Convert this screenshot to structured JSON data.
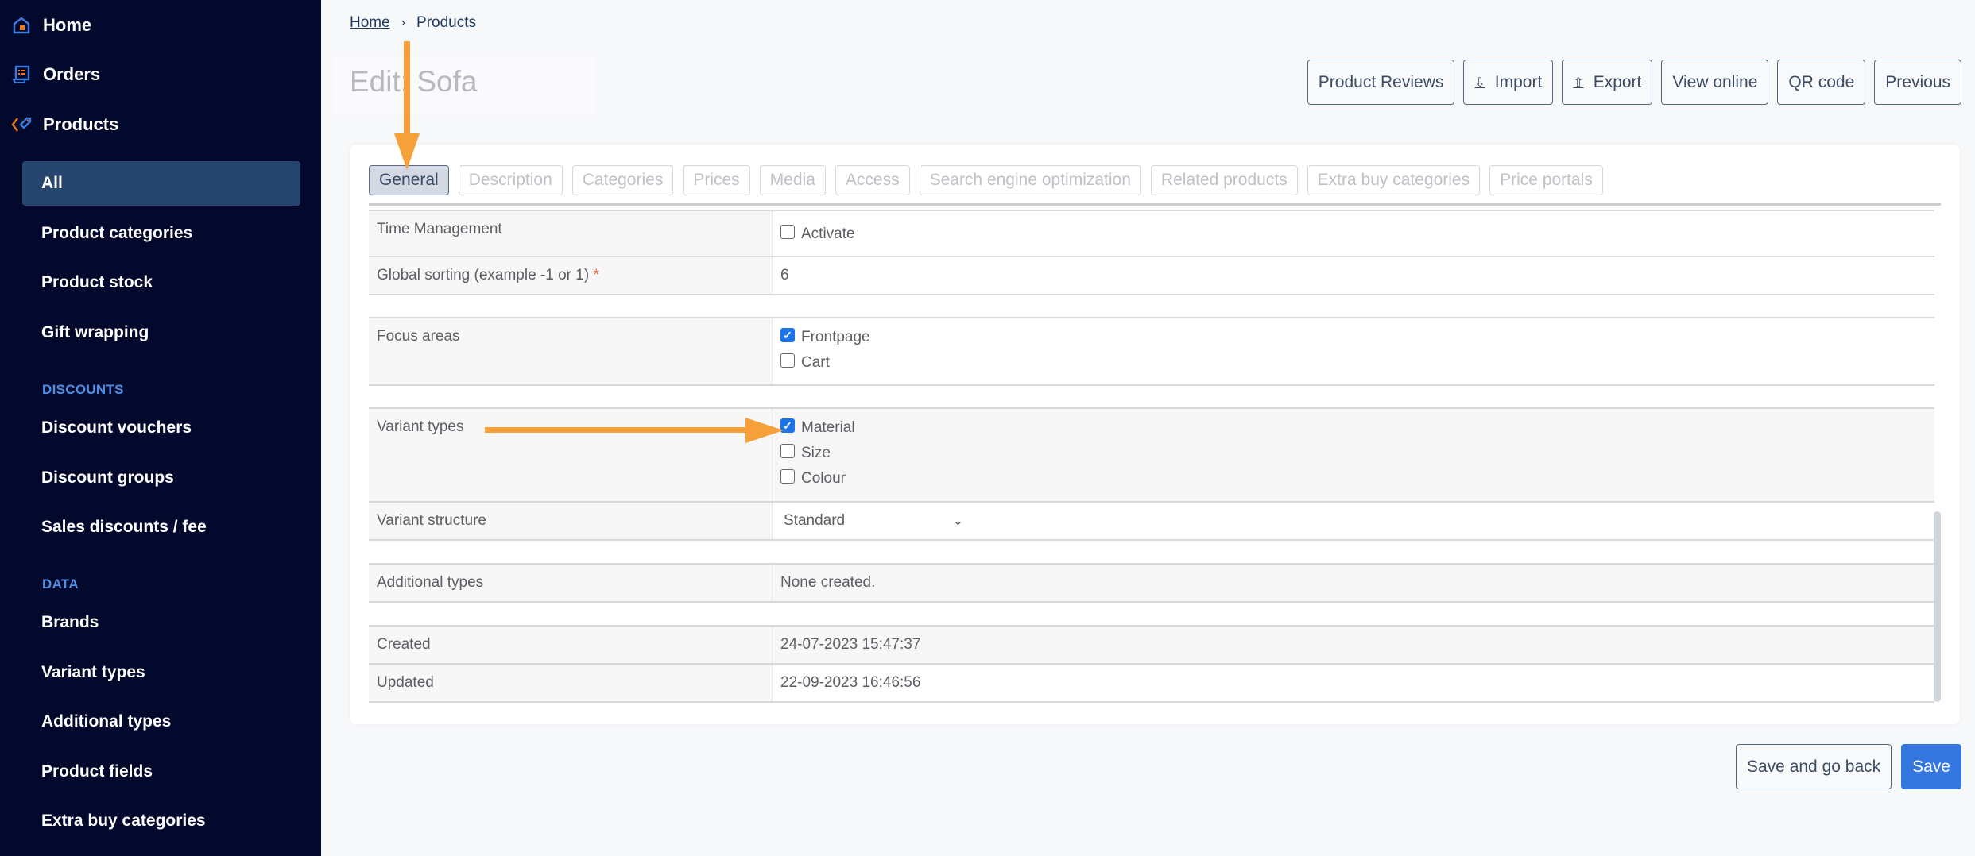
{
  "sidebar": {
    "top_items": [
      {
        "label": "Home",
        "icon": "home-icon"
      },
      {
        "label": "Orders",
        "icon": "orders-icon"
      },
      {
        "label": "Products",
        "icon": "tag-icon"
      }
    ],
    "product_items": [
      {
        "label": "All",
        "active": true
      },
      {
        "label": "Product categories"
      },
      {
        "label": "Product stock"
      },
      {
        "label": "Gift wrapping"
      }
    ],
    "discounts_heading": "DISCOUNTS",
    "discount_items": [
      {
        "label": "Discount vouchers"
      },
      {
        "label": "Discount groups"
      },
      {
        "label": "Sales discounts / fee"
      }
    ],
    "data_heading": "DATA",
    "data_items": [
      {
        "label": "Brands"
      },
      {
        "label": "Variant types"
      },
      {
        "label": "Additional types"
      },
      {
        "label": "Product fields"
      },
      {
        "label": "Extra buy categories"
      }
    ]
  },
  "breadcrumb": {
    "home": "Home",
    "separator": "›",
    "current": "Products"
  },
  "page_title": "Edit: Sofa",
  "top_actions": {
    "product_reviews": "Product Reviews",
    "import": "Import",
    "import_icon": "⇩",
    "export": "Export",
    "export_icon": "⇧",
    "view_online": "View online",
    "qr_code": "QR code",
    "previous": "Previous"
  },
  "tabs": [
    {
      "label": "General",
      "active": true
    },
    {
      "label": "Description"
    },
    {
      "label": "Categories"
    },
    {
      "label": "Prices"
    },
    {
      "label": "Media"
    },
    {
      "label": "Access"
    },
    {
      "label": "Search engine optimization"
    },
    {
      "label": "Related products"
    },
    {
      "label": "Extra buy categories"
    },
    {
      "label": "Price portals"
    }
  ],
  "form": {
    "time_management": {
      "label": "Time Management",
      "option": "Activate",
      "checked": false
    },
    "global_sorting": {
      "label": "Global sorting (example -1 or 1)",
      "required_mark": "*",
      "value": "6"
    },
    "focus_areas": {
      "label": "Focus areas",
      "options": [
        {
          "label": "Frontpage",
          "checked": true
        },
        {
          "label": "Cart",
          "checked": false
        }
      ]
    },
    "variant_types": {
      "label": "Variant types",
      "options": [
        {
          "label": "Material",
          "checked": true
        },
        {
          "label": "Size",
          "checked": false
        },
        {
          "label": "Colour",
          "checked": false
        }
      ]
    },
    "variant_structure": {
      "label": "Variant structure",
      "value": "Standard"
    },
    "additional_types": {
      "label": "Additional types",
      "value": "None created."
    },
    "created": {
      "label": "Created",
      "value": "24-07-2023 15:47:37"
    },
    "updated": {
      "label": "Updated",
      "value": "22-09-2023 16:46:56"
    }
  },
  "bottom_actions": {
    "save_and_go_back": "Save and go back",
    "save": "Save"
  },
  "colors": {
    "sidebar_bg": "#03082d",
    "active_nav": "#26466f",
    "accent": "#3577e0",
    "annotation_arrow": "#f6a03a"
  }
}
